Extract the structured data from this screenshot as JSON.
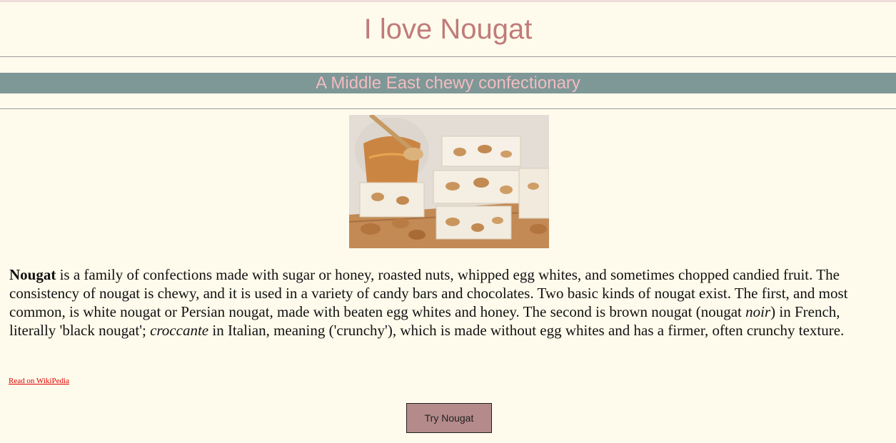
{
  "header": {
    "title": "I love Nougat",
    "subtitle": "A Middle East chewy confectionary"
  },
  "hero": {
    "image_subject": "nougat-with-almonds-and-honey"
  },
  "article": {
    "term": "Nougat",
    "part1": " is a family of confections made with sugar or honey, roasted nuts, whipped egg whites, and sometimes chopped candied fruit. The consistency of nougat is chewy, and it is used in a variety of candy bars and chocolates. Two basic kinds of nougat exist. The first, and most common, is white nougat or Persian nougat, made with beaten egg whites and honey. The second is brown nougat (nougat ",
    "noir": "noir",
    "part2": ") in French, literally 'black nougat'; ",
    "croccante": "croccante",
    "part3": " in Italian, meaning ('crunchy'), which is made without egg whites and has a firmer, often crunchy texture."
  },
  "links": {
    "wiki_label": "Read on WikiPedia"
  },
  "actions": {
    "try_label": "Try Nougat"
  },
  "colors": {
    "background": "#fffbec",
    "title": "#c07b7b",
    "subtitle_bar": "#7e9797",
    "subtitle_text": "#f1bcc0",
    "link": "#e00000",
    "button": "#b48a8a"
  }
}
